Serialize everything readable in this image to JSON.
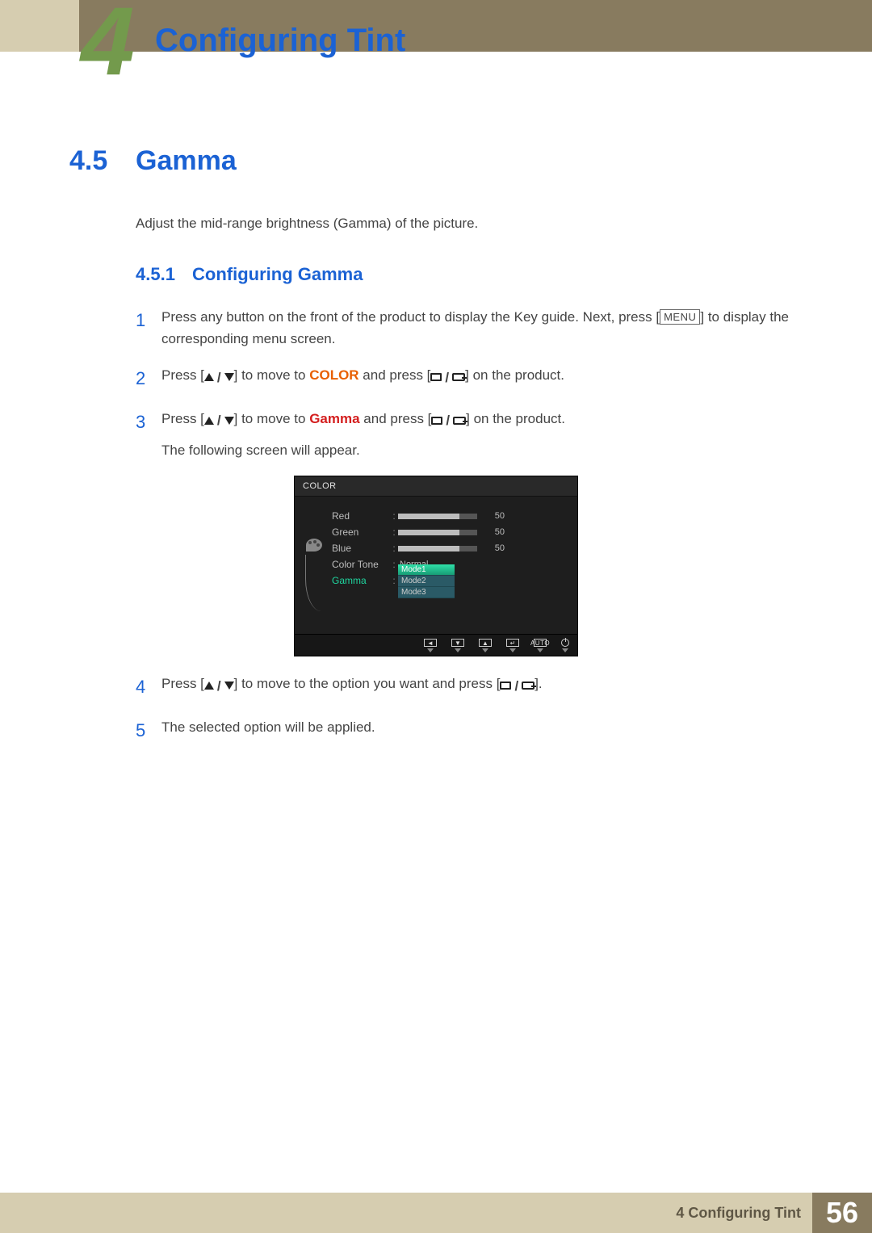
{
  "header": {
    "chapter_number": "4",
    "page_title": "Configuring Tint"
  },
  "section": {
    "number": "4.5",
    "title": "Gamma",
    "intro": "Adjust the mid-range brightness (Gamma) of the picture."
  },
  "subsection": {
    "number": "4.5.1",
    "title": "Configuring Gamma"
  },
  "steps": {
    "s1": {
      "num": "1",
      "pre": "Press any button on the front of the product to display the Key guide. Next, press [",
      "menu": "MENU",
      "post": "] to display the corresponding menu screen."
    },
    "s2": {
      "num": "2",
      "pre": "Press [",
      "mid": "] to move to ",
      "kw": "COLOR",
      "post1": " and press [",
      "post2": "] on the product."
    },
    "s3": {
      "num": "3",
      "pre": "Press [",
      "mid": "] to move to ",
      "kw": "Gamma",
      "post1": " and press [",
      "post2": "] on the product.",
      "sub": "The following screen will appear."
    },
    "s4": {
      "num": "4",
      "pre": "Press [",
      "mid": "] to move to the option you want and press [",
      "post": "]."
    },
    "s5": {
      "num": "5",
      "text": "The selected option will be applied."
    }
  },
  "osd": {
    "title": "COLOR",
    "rows": {
      "red": {
        "label": "Red",
        "value": "50"
      },
      "green": {
        "label": "Green",
        "value": "50"
      },
      "blue": {
        "label": "Blue",
        "value": "50"
      },
      "tone": {
        "label": "Color Tone",
        "value": "Normal"
      },
      "gamma": {
        "label": "Gamma"
      }
    },
    "modes": {
      "m1": "Mode1",
      "m2": "Mode2",
      "m3": "Mode3"
    },
    "footer": {
      "auto": "AUTO"
    }
  },
  "footer": {
    "breadcrumb": "4 Configuring Tint",
    "page_number": "56"
  }
}
